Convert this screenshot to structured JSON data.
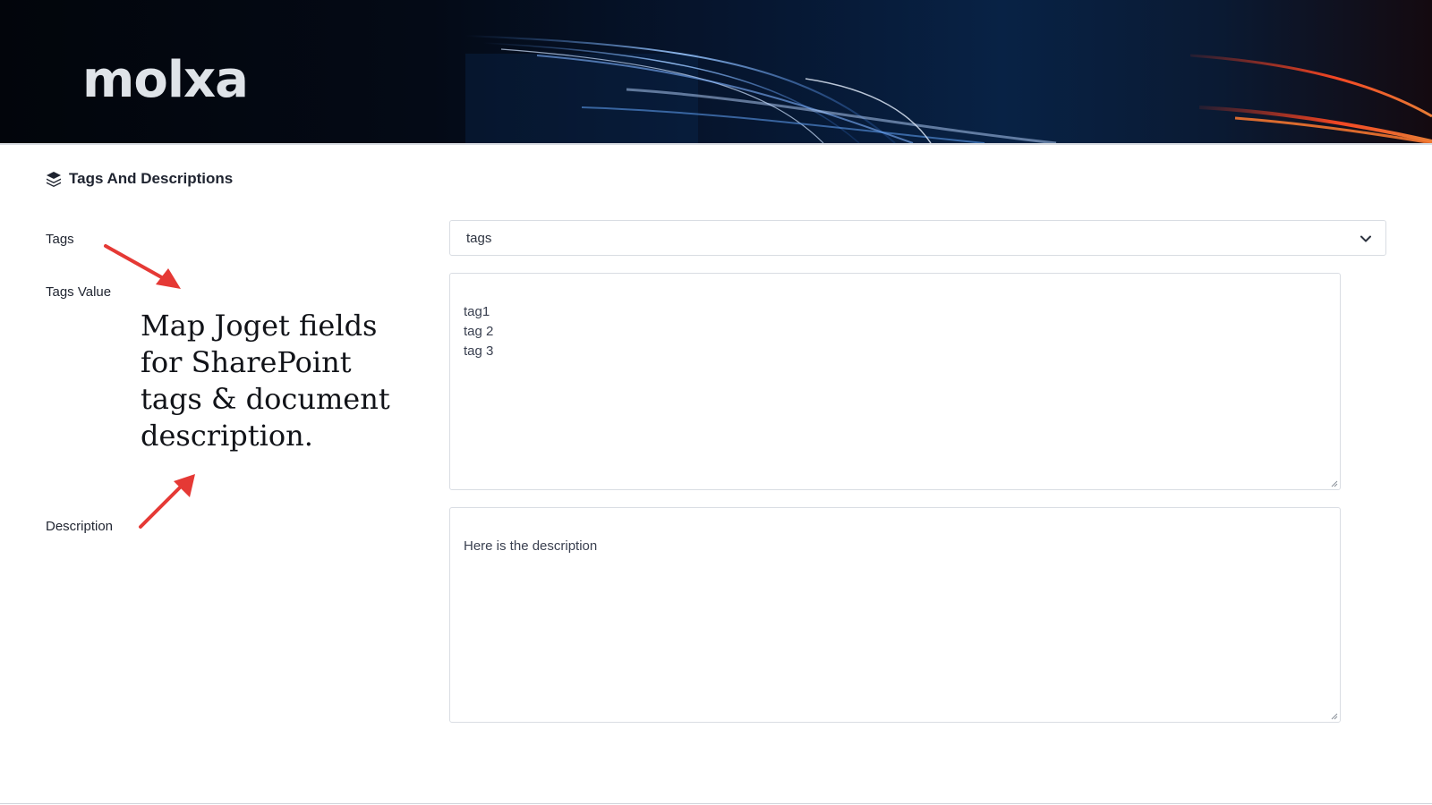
{
  "banner": {
    "logo_text": "molxa"
  },
  "section": {
    "icon": "layers-stack-icon",
    "title": "Tags And Descriptions"
  },
  "fields": {
    "tags_label": "Tags",
    "tags_value_label": "Tags Value",
    "description_label": "Description",
    "tags_select_value": "tags",
    "tags_value_text": "tag1\ntag 2\ntag 3",
    "description_text": "Here is the description"
  },
  "annotation": {
    "text": "Map Joget fields for SharePoint tags & document description.",
    "arrow_color": "#e53935"
  },
  "colors": {
    "accent_arrow": "#e53935",
    "banner_dark": "#02050b",
    "border": "#d9dde3"
  }
}
